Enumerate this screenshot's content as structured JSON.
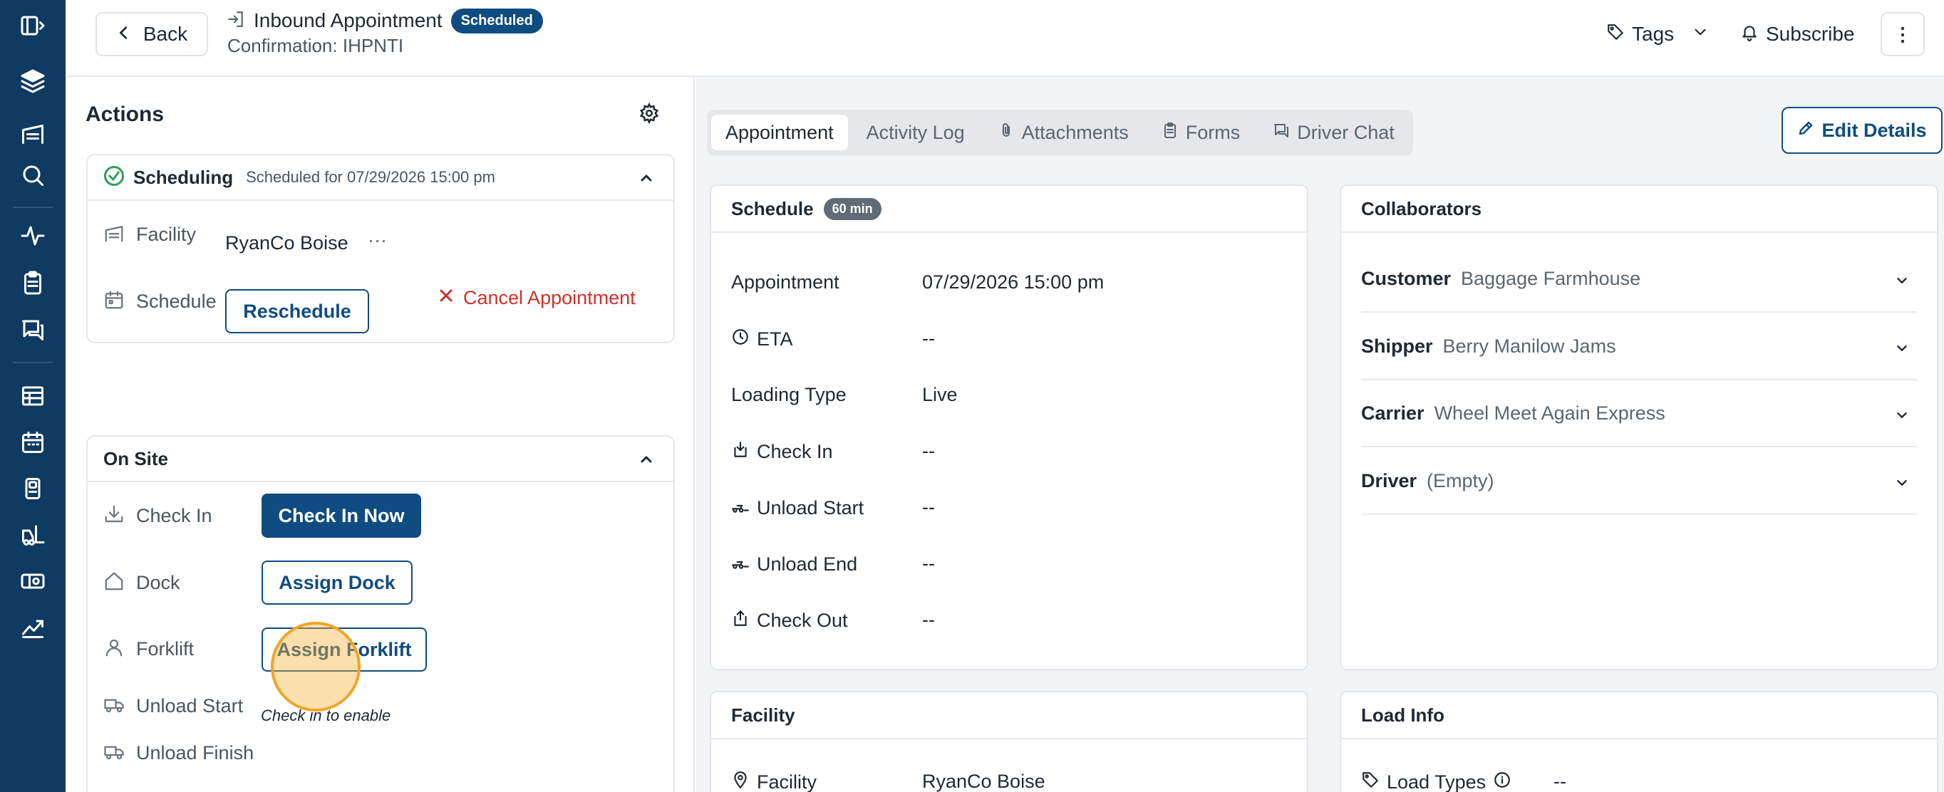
{
  "colors": {
    "primary": "#0f4c81",
    "sidebar": "#0f3a61",
    "success": "#2f9e5b",
    "danger": "#d0302b"
  },
  "sidebar": {
    "icons": [
      "sidebar-toggle-icon",
      "warehouse-logo-icon",
      "dock-icon",
      "search-icon",
      "activity-icon",
      "clipboard-icon",
      "messages-icon",
      "table-icon",
      "calendar-icon",
      "building-icon",
      "forklift-icon",
      "truck-icon",
      "chart-icon"
    ]
  },
  "header": {
    "back_label": "Back",
    "title": "Inbound Appointment",
    "status_badge": "Scheduled",
    "confirmation": "Confirmation: IHPNTI",
    "tags_label": "Tags",
    "subscribe_label": "Subscribe",
    "more_label": "⋮"
  },
  "actions": {
    "title": "Actions",
    "scheduling": {
      "title": "Scheduling",
      "subtitle": "Scheduled for 07/29/2026 15:00 pm",
      "facility_label": "Facility",
      "facility_value": "RyanCo Boise",
      "facility_more": "···",
      "schedule_label": "Schedule",
      "reschedule_label": "Reschedule",
      "cancel_label": "Cancel Appointment"
    },
    "onsite": {
      "title": "On Site",
      "checkin_label": "Check In",
      "checkin_button": "Check In Now",
      "dock_label": "Dock",
      "dock_button": "Assign Dock",
      "forklift_label": "Forklift",
      "forklift_button": "Assign Forklift",
      "unload_start_label": "Unload Start",
      "unload_start_hint": "Check in to enable",
      "unload_finish_label": "Unload Finish"
    }
  },
  "tabs": [
    {
      "label": "Appointment",
      "active": true
    },
    {
      "label": "Activity Log",
      "active": false
    },
    {
      "label": "Attachments",
      "active": false
    },
    {
      "label": "Forms",
      "active": false
    },
    {
      "label": "Driver Chat",
      "active": false
    }
  ],
  "edit_details_label": "Edit Details",
  "schedule": {
    "title": "Schedule",
    "duration": "60 min",
    "appointment_label": "Appointment",
    "appointment_value": "07/29/2026 15:00 pm",
    "eta_label": "ETA",
    "eta_value": "--",
    "loading_type_label": "Loading Type",
    "loading_type_value": "Live",
    "check_in_label": "Check In",
    "check_in_value": "--",
    "unload_start_label": "Unload Start",
    "unload_start_value": "--",
    "unload_end_label": "Unload End",
    "unload_end_value": "--",
    "check_out_label": "Check Out",
    "check_out_value": "--"
  },
  "collaborators": {
    "title": "Collaborators",
    "rows": [
      {
        "label": "Customer",
        "value": "Baggage Farmhouse"
      },
      {
        "label": "Shipper",
        "value": "Berry Manilow Jams"
      },
      {
        "label": "Carrier",
        "value": "Wheel Meet Again Express"
      },
      {
        "label": "Driver",
        "value": "(Empty)"
      }
    ]
  },
  "facility_panel": {
    "title": "Facility",
    "facility_label": "Facility",
    "facility_value": "RyanCo Boise"
  },
  "load_info": {
    "title": "Load Info",
    "load_types_label": "Load Types",
    "load_types_value": "--"
  }
}
